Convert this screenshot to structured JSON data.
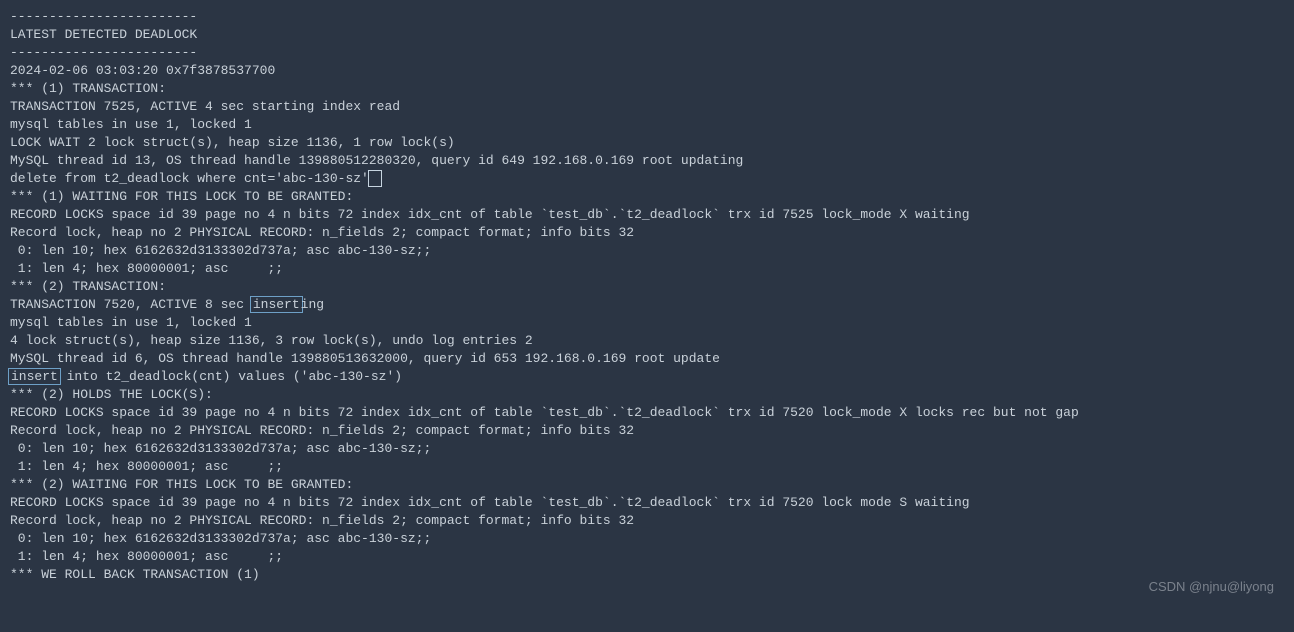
{
  "lines": {
    "l0": "------------------------",
    "l1": "LATEST DETECTED DEADLOCK",
    "l2": "------------------------",
    "l3": "2024-02-06 03:03:20 0x7f3878537700",
    "l4": "*** (1) TRANSACTION:",
    "l5": "TRANSACTION 7525, ACTIVE 4 sec starting index read",
    "l6": "mysql tables in use 1, locked 1",
    "l7": "LOCK WAIT 2 lock struct(s), heap size 1136, 1 row lock(s)",
    "l8": "MySQL thread id 13, OS thread handle 139880512280320, query id 649 192.168.0.169 root updating",
    "l9a": "delete from t2_deadlock where cnt='abc-130-sz'",
    "l10": "*** (1) WAITING FOR THIS LOCK TO BE GRANTED:",
    "l11": "RECORD LOCKS space id 39 page no 4 n bits 72 index idx_cnt of table `test_db`.`t2_deadlock` trx id 7525 lock_mode X waiting",
    "l12": "Record lock, heap no 2 PHYSICAL RECORD: n_fields 2; compact format; info bits 32",
    "l13": " 0: len 10; hex 6162632d3133302d737a; asc abc-130-sz;;",
    "l14": " 1: len 4; hex 80000001; asc     ;;",
    "l15": "",
    "l16": "*** (2) TRANSACTION:",
    "l17a": "TRANSACTION 7520, ACTIVE 8 sec ",
    "l17box": "insert",
    "l17b": "ing",
    "l18": "mysql tables in use 1, locked 1",
    "l19": "4 lock struct(s), heap size 1136, 3 row lock(s), undo log entries 2",
    "l20": "MySQL thread id 6, OS thread handle 139880513632000, query id 653 192.168.0.169 root update",
    "l21box": "insert",
    "l21b": " into t2_deadlock(cnt) values ('abc-130-sz')",
    "l22": "*** (2) HOLDS THE LOCK(S):",
    "l23": "RECORD LOCKS space id 39 page no 4 n bits 72 index idx_cnt of table `test_db`.`t2_deadlock` trx id 7520 lock_mode X locks rec but not gap",
    "l24": "Record lock, heap no 2 PHYSICAL RECORD: n_fields 2; compact format; info bits 32",
    "l25": " 0: len 10; hex 6162632d3133302d737a; asc abc-130-sz;;",
    "l26": " 1: len 4; hex 80000001; asc     ;;",
    "l27": "",
    "l28": "*** (2) WAITING FOR THIS LOCK TO BE GRANTED:",
    "l29": "RECORD LOCKS space id 39 page no 4 n bits 72 index idx_cnt of table `test_db`.`t2_deadlock` trx id 7520 lock mode S waiting",
    "l30": "Record lock, heap no 2 PHYSICAL RECORD: n_fields 2; compact format; info bits 32",
    "l31": " 0: len 10; hex 6162632d3133302d737a; asc abc-130-sz;;",
    "l32": " 1: len 4; hex 80000001; asc     ;;",
    "l33": "",
    "l34": "*** WE ROLL BACK TRANSACTION (1)"
  },
  "watermark": "CSDN @njnu@liyong"
}
